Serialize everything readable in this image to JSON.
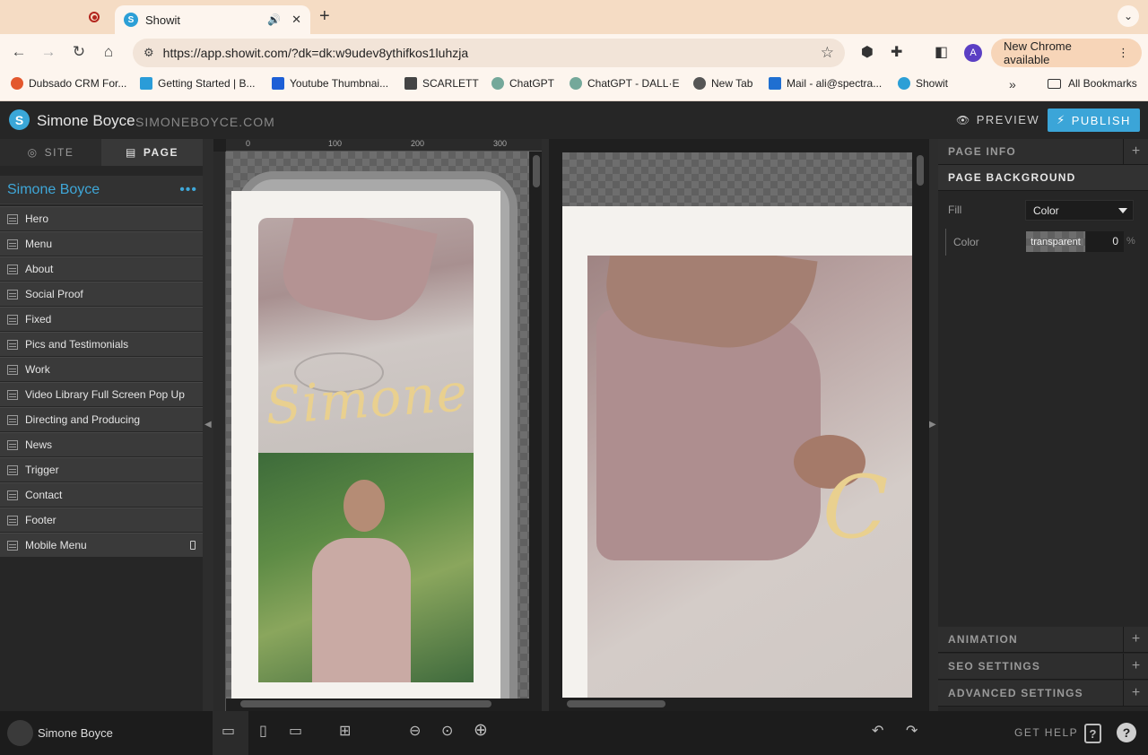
{
  "browser": {
    "tab_title": "Showit",
    "url": "https://app.showit.com/?dk=dk:w9udev8ythifkos1luhzja",
    "update_label": "New Chrome available",
    "profile_initial": "A",
    "bookmarks": [
      {
        "label": "Dubsado CRM For...",
        "color": "#e3572d"
      },
      {
        "label": "Getting Started | B...",
        "color": "#2a9cd8"
      },
      {
        "label": "Youtube Thumbnai...",
        "color": "#1d5fd6"
      },
      {
        "label": "SCARLETT",
        "color": "#444444"
      },
      {
        "label": "ChatGPT",
        "color": "#74a89a"
      },
      {
        "label": "ChatGPT - DALL·E",
        "color": "#74a89a"
      },
      {
        "label": "New Tab",
        "color": "#555555"
      },
      {
        "label": "Mail - ali@spectra...",
        "color": "#1f6fd1"
      },
      {
        "label": "Showit",
        "color": "#2c9fd6"
      }
    ],
    "all_bookmarks": "All Bookmarks"
  },
  "app": {
    "site_title": "Simone Boyce",
    "site_domain": "SIMONEBOYCE.COM",
    "preview_label": "PREVIEW",
    "publish_label": "PUBLISH"
  },
  "left_panel": {
    "tab_site": "SITE",
    "tab_page": "PAGE",
    "page_name": "Simone Boyce",
    "canvases": [
      "Hero",
      "Menu",
      "About",
      "Social Proof",
      "Fixed",
      "Pics and Testimonials",
      "Work",
      "Video Library Full Screen Pop Up",
      "Directing and Producing",
      "News",
      "Trigger",
      "Contact",
      "Footer",
      "Mobile Menu"
    ]
  },
  "canvas": {
    "ruler_marks": [
      "0",
      "100",
      "200",
      "300"
    ],
    "mobile_script": "Simone",
    "desktop_script": "C"
  },
  "right_panel": {
    "page_info": "PAGE INFO",
    "page_background": "PAGE BACKGROUND",
    "fill_label": "Fill",
    "fill_value": "Color",
    "color_label": "Color",
    "color_value": "transparent",
    "opacity_value": "0",
    "opacity_unit": "%",
    "animation": "ANIMATION",
    "seo_settings": "SEO SETTINGS",
    "advanced_settings": "ADVANCED SETTINGS"
  },
  "footer": {
    "user_name": "Simone Boyce",
    "get_help": "GET HELP"
  },
  "colors": {
    "accent": "#3ba5d8",
    "script_gold": "#e9d08f"
  }
}
